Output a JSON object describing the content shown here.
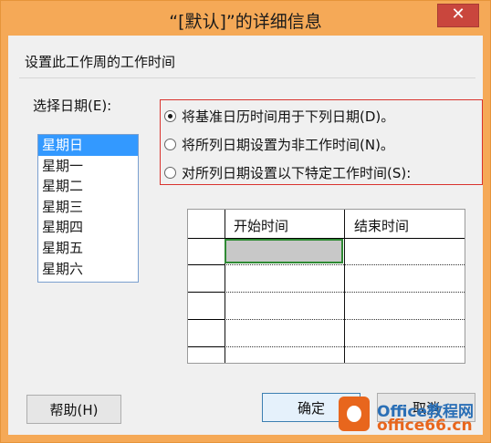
{
  "window": {
    "title": "“[默认]”的详细信息",
    "close_glyph": "✕"
  },
  "section_label": "设置此工作周的工作时间",
  "choose_date_label": "选择日期(E):",
  "days": [
    "星期日",
    "星期一",
    "星期二",
    "星期三",
    "星期四",
    "星期五",
    "星期六"
  ],
  "selected_day_index": 0,
  "radio_options": [
    {
      "label": "将基准日历时间用于下列日期(D)。",
      "checked": true
    },
    {
      "label": "将所列日期设置为非工作时间(N)。",
      "checked": false
    },
    {
      "label": "对所列日期设置以下特定工作时间(S):",
      "checked": false
    }
  ],
  "table": {
    "headers": [
      "开始时间",
      "结束时间"
    ],
    "rows": 5
  },
  "buttons": {
    "help": "帮助(H)",
    "ok": "确定",
    "cancel": "取消"
  },
  "watermark": {
    "brand_line1": "Office教程网",
    "brand_line2": "office66.cn"
  },
  "colors": {
    "window_frame": "#f5a957",
    "selection": "#3399ff",
    "highlight_box": "#d9332e",
    "active_cell_border": "#2f8a34"
  }
}
